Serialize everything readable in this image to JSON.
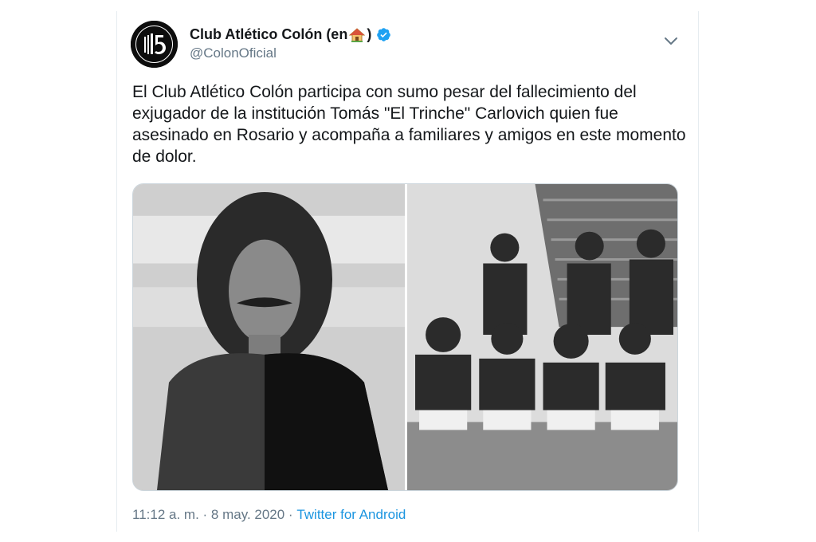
{
  "tweet": {
    "author": {
      "name": "Club Atlético Colón (en",
      "name_suffix": ")",
      "handle": "@ColonOficial",
      "verified": true,
      "avatar_icon": "club-crest-icon"
    },
    "text": "El Club Atlético Colón participa con sumo pesar del fallecimiento del exjugador de la institución Tomás \"El Trinche\" Carlovich quien fue asesinado en Rosario y acompaña a familiares y amigos en este momento de dolor.",
    "time": "11:12 a. m.",
    "separator": " · ",
    "date": "8 may. 2020",
    "source": "Twitter for Android",
    "media": [
      {
        "kind": "photo",
        "description_icon": "player-portrait-photo"
      },
      {
        "kind": "photo",
        "description_icon": "team-photo"
      }
    ]
  },
  "colors": {
    "link": "#1b95e0",
    "secondary": "#657786",
    "text": "#14171a",
    "verified": "#1da1f2"
  }
}
